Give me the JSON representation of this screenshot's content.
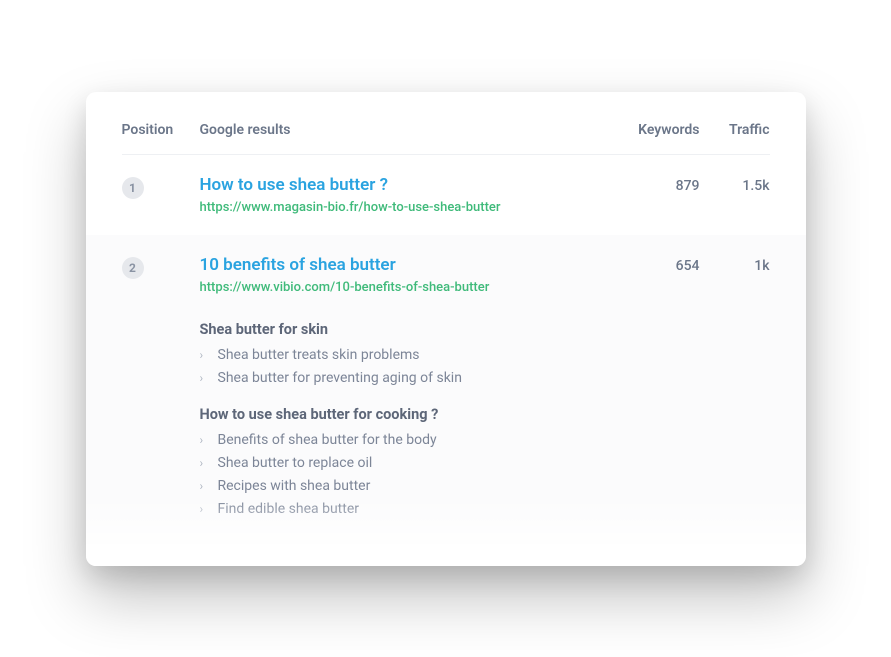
{
  "headers": {
    "position": "Position",
    "results": "Google results",
    "keywords": "Keywords",
    "traffic": "Traffic"
  },
  "rows": [
    {
      "position": "1",
      "title": "How to use shea butter ?",
      "url": "https://www.magasin-bio.fr/how-to-use-shea-butter",
      "keywords": "879",
      "traffic": "1.5k"
    },
    {
      "position": "2",
      "title": "10 benefits of shea butter",
      "url": "https://www.vibio.com/10-benefits-of-shea-butter",
      "keywords": "654",
      "traffic": "1k",
      "sections": [
        {
          "title": "Shea butter for skin",
          "items": [
            "Shea butter treats skin problems",
            "Shea butter for preventing aging of skin"
          ]
        },
        {
          "title": "How to use shea butter for cooking ?",
          "items": [
            "Benefits of shea butter for the body",
            "Shea butter to replace oil",
            "Recipes with shea butter",
            "Find edible shea butter"
          ]
        }
      ]
    }
  ]
}
